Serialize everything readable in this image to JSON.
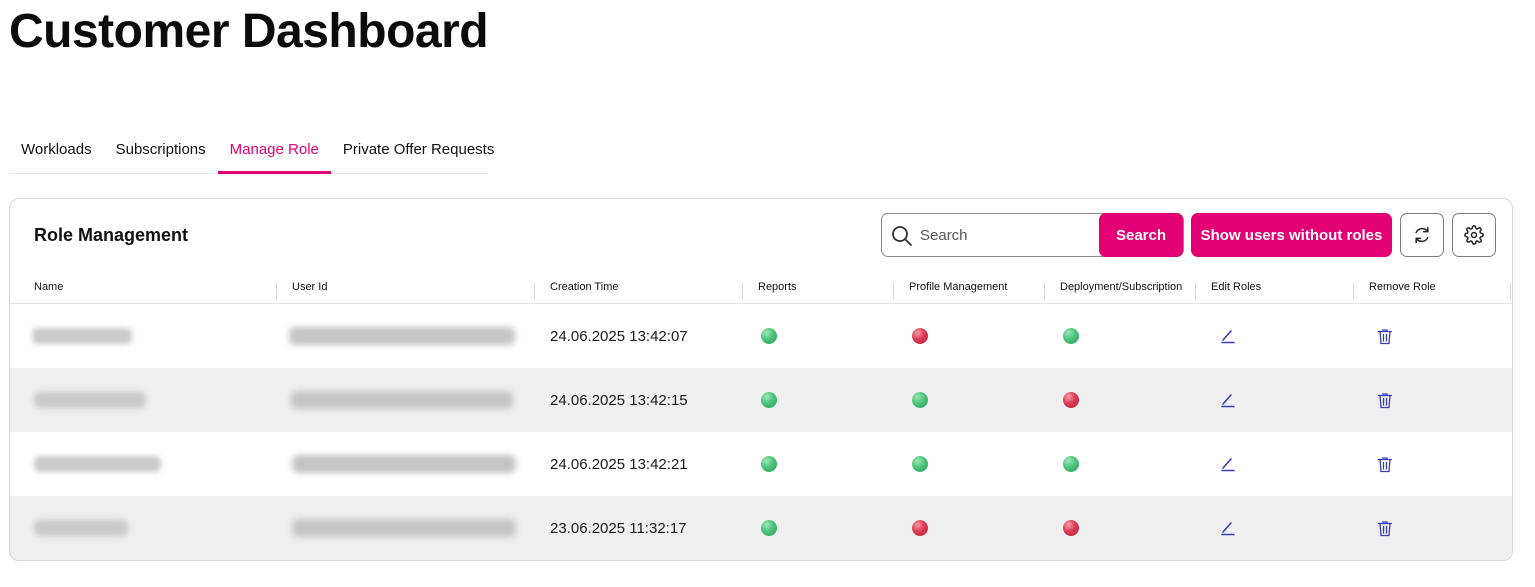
{
  "page": {
    "title": "Customer Dashboard"
  },
  "tabs": [
    {
      "label": "Workloads",
      "active": false
    },
    {
      "label": "Subscriptions",
      "active": false
    },
    {
      "label": "Manage Role",
      "active": true
    },
    {
      "label": "Private Offer Requests",
      "active": false
    }
  ],
  "card": {
    "title": "Role Management",
    "search": {
      "placeholder": "Search",
      "value": ""
    },
    "search_button": "Search",
    "show_users_button": "Show users without roles",
    "refresh_icon": "refresh-icon",
    "settings_icon": "gear-icon"
  },
  "table": {
    "headers": {
      "name": "Name",
      "user_id": "User Id",
      "creation_time": "Creation Time",
      "reports": "Reports",
      "profile_management": "Profile Management",
      "deployment_subscription": "Deployment/Subscription",
      "edit_roles": "Edit Roles",
      "remove_role": "Remove Role"
    },
    "rows": [
      {
        "creation_time": "24.06.2025 13:42:07",
        "reports": true,
        "profile_management": false,
        "deployment_subscription": true
      },
      {
        "creation_time": "24.06.2025 13:42:15",
        "reports": true,
        "profile_management": true,
        "deployment_subscription": false
      },
      {
        "creation_time": "24.06.2025 13:42:21",
        "reports": true,
        "profile_management": true,
        "deployment_subscription": true
      },
      {
        "creation_time": "23.06.2025 11:32:17",
        "reports": true,
        "profile_management": false,
        "deployment_subscription": false
      }
    ]
  },
  "colors": {
    "accent": "#e20074",
    "status_on": "#4cc27a",
    "status_off": "#dc3a55",
    "action_icon": "#3a3fb5"
  }
}
